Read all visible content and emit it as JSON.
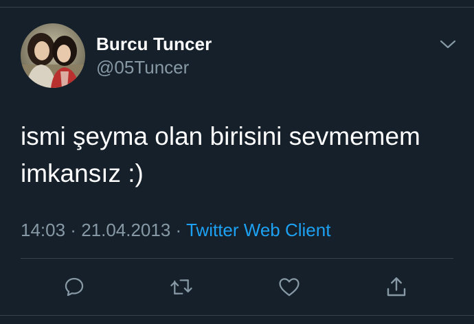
{
  "user": {
    "display_name": "Burcu Tuncer",
    "handle": "@05Tuncer"
  },
  "tweet": {
    "text": "ismi şeyma olan birisini sevmemem imkansız :)",
    "time": "14:03",
    "separator": " · ",
    "date": "21.04.2013",
    "source": "Twitter Web Client"
  },
  "icons": {
    "more": "chevron-down-icon",
    "reply": "reply-icon",
    "retweet": "retweet-icon",
    "like": "heart-icon",
    "share": "share-icon"
  },
  "colors": {
    "background": "#15202b",
    "text": "#ffffff",
    "muted": "#8899a6",
    "link": "#1da1f2",
    "divider": "#38444d"
  }
}
